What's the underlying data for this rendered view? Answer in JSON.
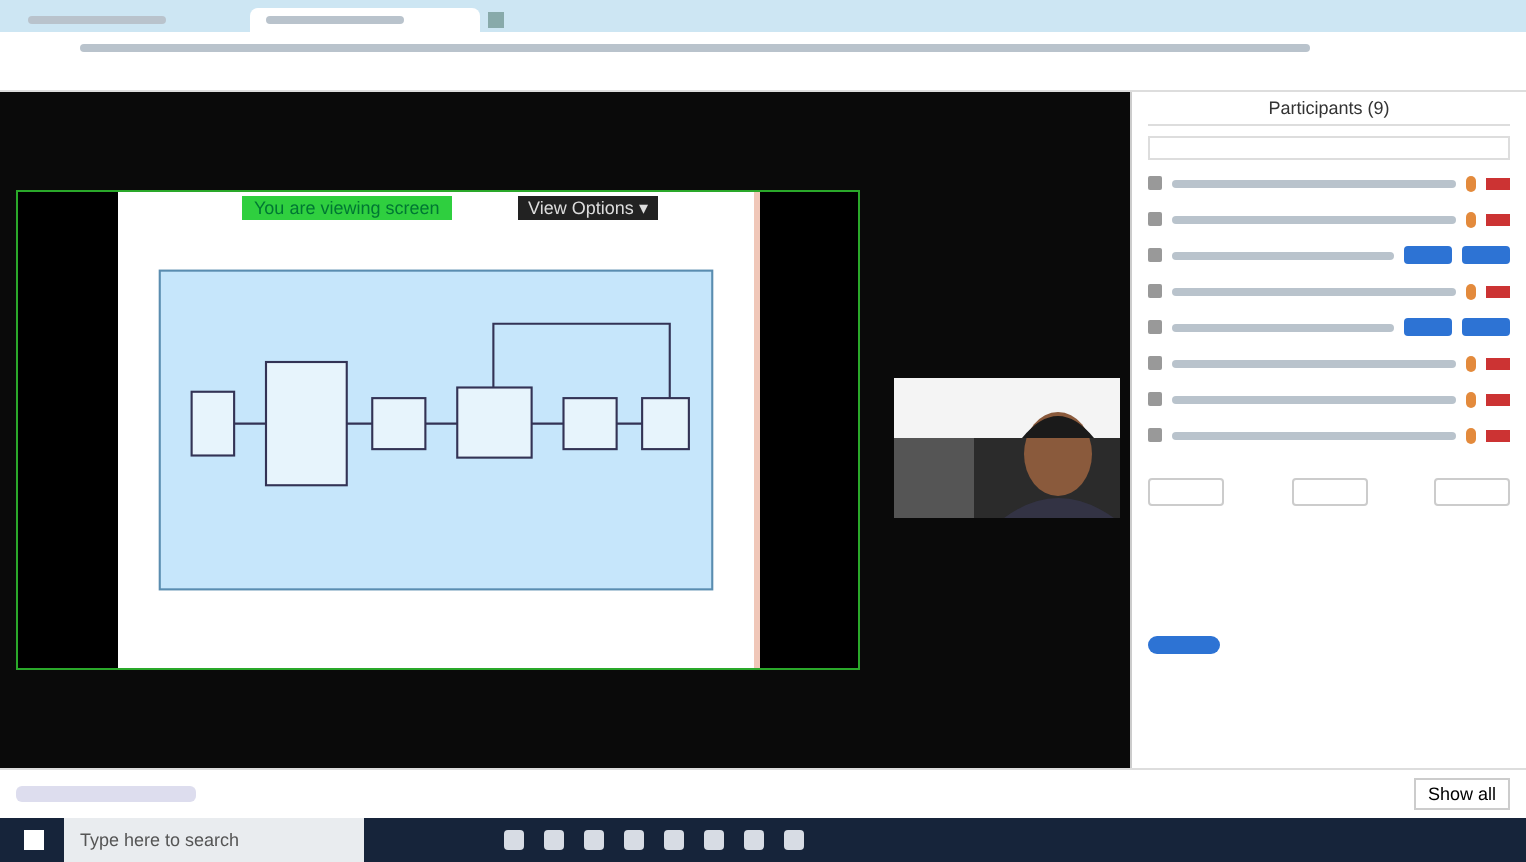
{
  "browser": {
    "tabs": [
      {
        "selected": false
      },
      {
        "selected": true
      }
    ]
  },
  "meeting": {
    "share_banner": "You are viewing screen",
    "view_options": "View Options ▾"
  },
  "participants_panel": {
    "title": "Participants (9)",
    "participants": [
      {
        "kind": "icons"
      },
      {
        "kind": "icons"
      },
      {
        "kind": "buttons"
      },
      {
        "kind": "icons"
      },
      {
        "kind": "buttons"
      },
      {
        "kind": "icons"
      },
      {
        "kind": "icons"
      },
      {
        "kind": "icons"
      }
    ]
  },
  "download_bar": {
    "show_all": "Show all"
  },
  "taskbar": {
    "search_placeholder": "Type here to search"
  }
}
